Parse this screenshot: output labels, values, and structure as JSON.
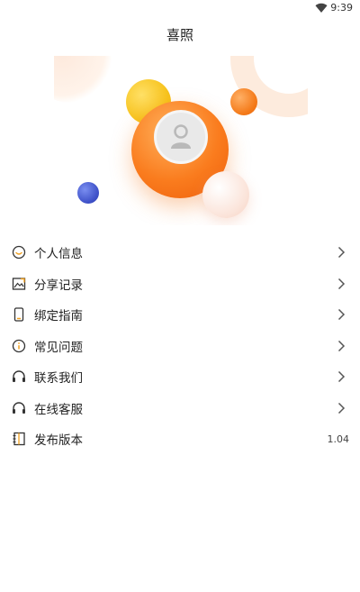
{
  "status_bar": {
    "time": "9:39"
  },
  "header": {
    "title": "喜照"
  },
  "menu": {
    "items": [
      {
        "label": "个人信息",
        "icon": "smile-face-icon"
      },
      {
        "label": "分享记录",
        "icon": "image-share-icon"
      },
      {
        "label": "绑定指南",
        "icon": "phone-icon"
      },
      {
        "label": "常见问题",
        "icon": "info-icon"
      },
      {
        "label": "联系我们",
        "icon": "headset-icon"
      },
      {
        "label": "在线客服",
        "icon": "headset-icon"
      },
      {
        "label": "发布版本",
        "icon": "notebook-icon",
        "value": "1.04"
      }
    ]
  }
}
